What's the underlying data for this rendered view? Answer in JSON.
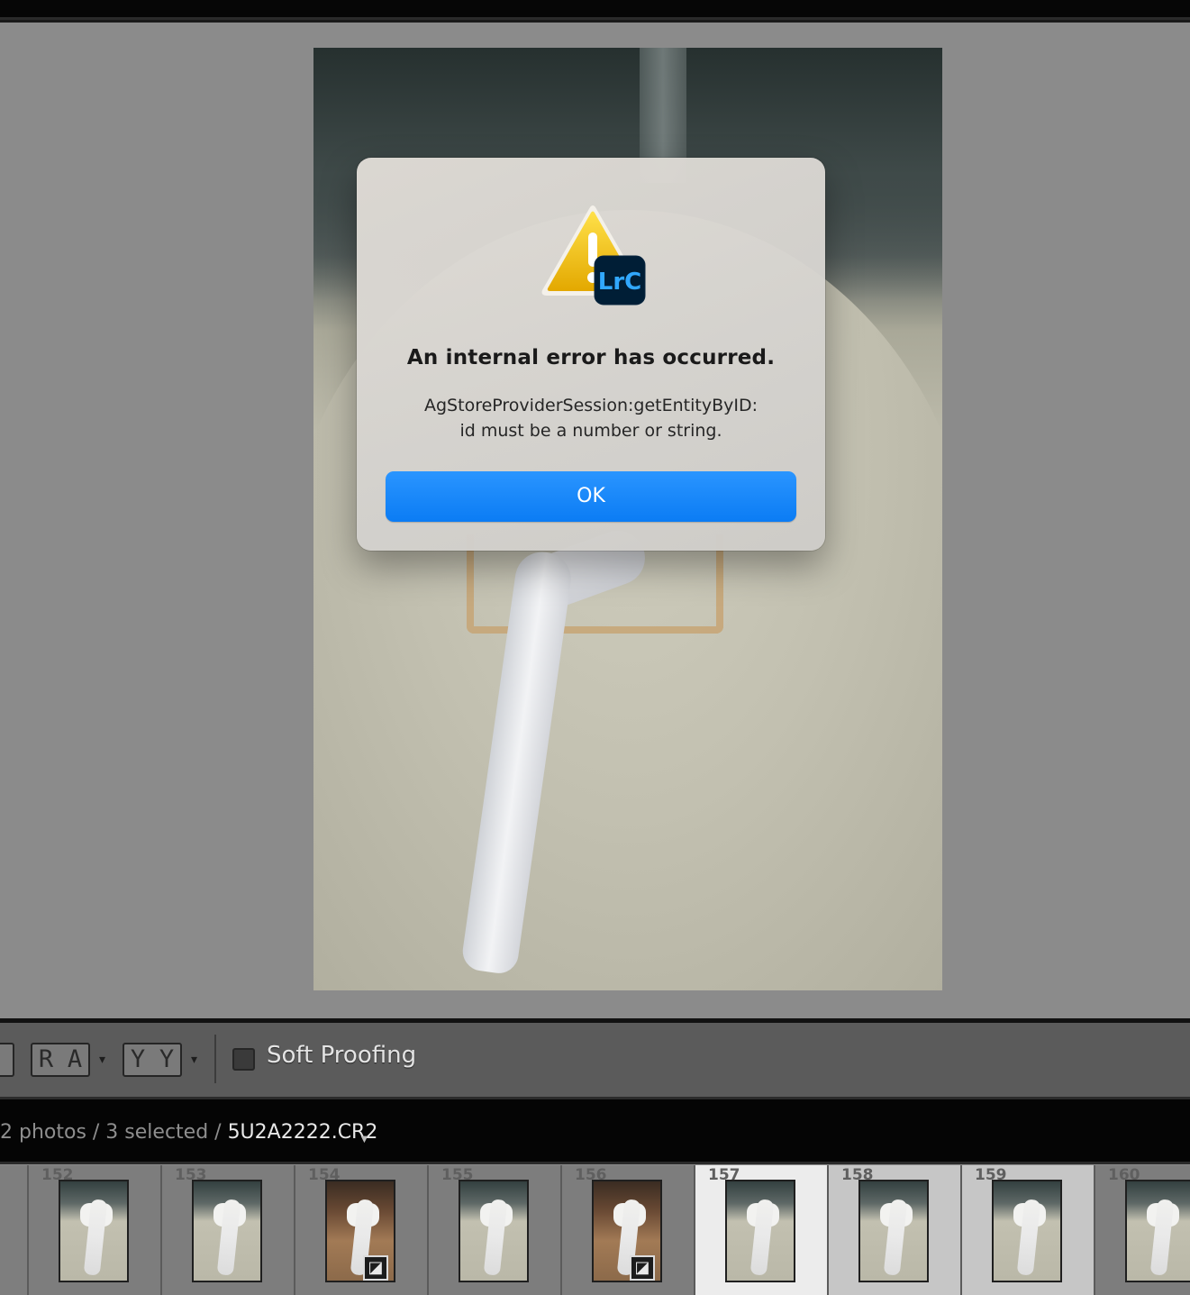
{
  "dialog": {
    "title": "An internal error has occurred.",
    "message_line1": "AgStoreProviderSession:getEntityByID:",
    "message_line2": "id must be a number or string.",
    "ok_label": "OK",
    "app_badge": "LrC",
    "icon": "warning-triangle-icon"
  },
  "toolbar": {
    "before_after_letters": [
      "R",
      "A"
    ],
    "yy_letters": [
      "Y",
      "Y"
    ],
    "soft_proofing_label": "Soft Proofing",
    "soft_proofing_checked": false
  },
  "info_bar": {
    "count_text": "2 photos / 3 selected / ",
    "file_name": "5U2A2222.CR2"
  },
  "filmstrip": {
    "cells": [
      {
        "number": "152",
        "style": "normal",
        "badge": false
      },
      {
        "number": "153",
        "style": "normal",
        "badge": false
      },
      {
        "number": "154",
        "style": "warm",
        "badge": true
      },
      {
        "number": "155",
        "style": "normal",
        "badge": false
      },
      {
        "number": "156",
        "style": "warm",
        "badge": true
      },
      {
        "number": "157",
        "style": "normal",
        "badge": false,
        "selected": "primary"
      },
      {
        "number": "158",
        "style": "normal",
        "badge": false,
        "selected": "secondary"
      },
      {
        "number": "159",
        "style": "normal",
        "badge": false,
        "selected": "secondary"
      },
      {
        "number": "160",
        "style": "normal",
        "badge": false
      }
    ],
    "badge_icon": "edit-adjustment-icon"
  },
  "colors": {
    "ok_button": "#0b7cf4",
    "lrc_badge_bg": "#001e36",
    "lrc_badge_text": "#31a8ff",
    "warning_yellow": "#f5c400"
  }
}
